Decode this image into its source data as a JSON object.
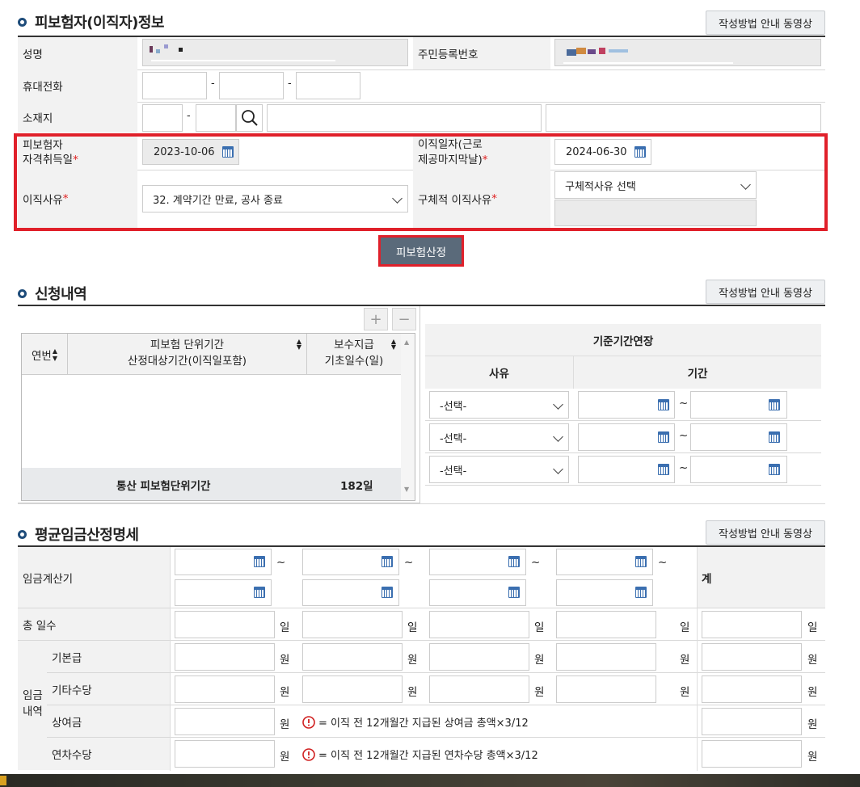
{
  "section1": {
    "title": "피보험자(이직자)정보",
    "guide_button": "작성방법 안내 동영상",
    "name_label": "성명",
    "rrn_label": "주민등록번호",
    "phone_label": "휴대전화",
    "address_label": "소재지",
    "phone_sep": "-",
    "zip_sep": "-",
    "acq_label_line1": "피보험자",
    "acq_label_line2": "자격취득일",
    "acq_date": "2023-10-06",
    "leave_label_line1": "이직일자(근로",
    "leave_label_line2": "제공마지막날)",
    "leave_date": "2024-06-30",
    "reason_label": "이직사유 ",
    "reason_value": "32. 계약기간 만료, 공사 종료",
    "detail_reason_label": "구체적 이직사유",
    "detail_reason_value": "구체적사유 선택",
    "required_mark": "*",
    "calc_button": "피보험산정"
  },
  "section2": {
    "title": "신청내역",
    "guide_button": "작성방법 안내 동영상",
    "add_button": "+",
    "remove_button": "−",
    "col_year": "연번",
    "col_period_line1": "피보험 단위기간",
    "col_period_line2": "산정대상기간(이직일포함)",
    "col_days_line1": "보수지급",
    "col_days_line2": "기초일수(일)",
    "total_label": "통산 피보험단위기간",
    "total_value": "182일",
    "extend_title": "기준기간연장",
    "extend_col_reason": "사유",
    "extend_col_period": "기간",
    "extend_rows": [
      {
        "reason": "-선택-",
        "tilde": "~"
      },
      {
        "reason": "-선택-",
        "tilde": "~"
      },
      {
        "reason": "-선택-",
        "tilde": "~"
      }
    ]
  },
  "section3": {
    "title": "평균임금산정명세",
    "guide_button": "작성방법 안내 동영상",
    "period_label": "임금계산기",
    "tilde": "~",
    "total_col": "계",
    "days_label": "총 일수",
    "day_unit": "일",
    "won_unit": "원",
    "wage_group_line1": "임금",
    "wage_group_line2": "내역",
    "basic_label": "기본급",
    "other_label": "기타수당",
    "bonus_label": "상여금",
    "annual_label": "연차수당",
    "bonus_note": "= 이직 전 12개월간 지급된 상여금 총액×3/12",
    "annual_note": "= 이직 전 12개월간 지급된 연차수당 총액×3/12"
  },
  "colors": {
    "accent": "#1e4c7a",
    "highlight": "#e0202a",
    "button": "#5a6a7a"
  }
}
